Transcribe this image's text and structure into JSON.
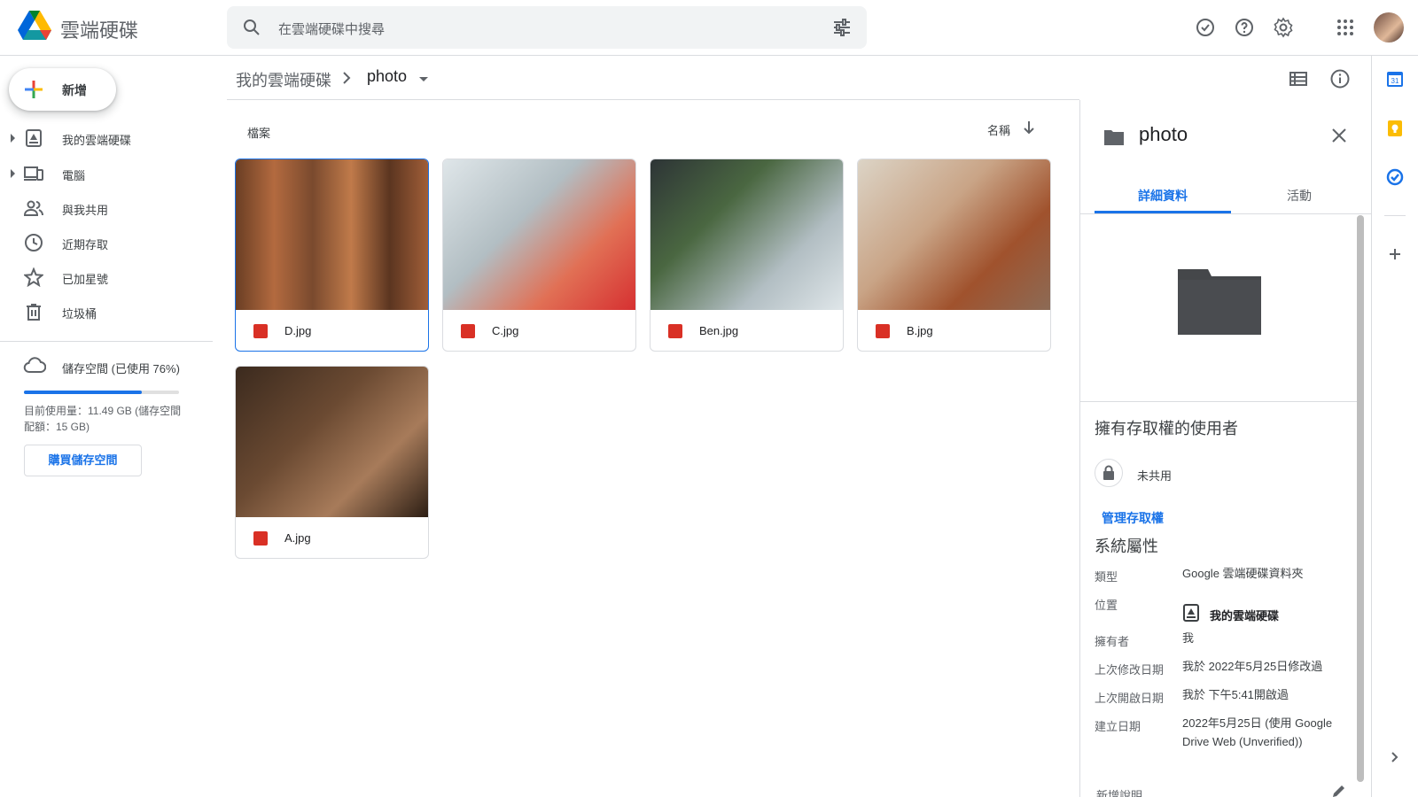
{
  "app": {
    "title": "雲端硬碟"
  },
  "search": {
    "placeholder": "在雲端硬碟中搜尋"
  },
  "sidebar": {
    "new_label": "新增",
    "items": [
      {
        "label": "我的雲端硬碟",
        "icon": "my-drive-icon"
      },
      {
        "label": "電腦",
        "icon": "computer-icon"
      },
      {
        "label": "與我共用",
        "icon": "shared-icon"
      },
      {
        "label": "近期存取",
        "icon": "clock-icon"
      },
      {
        "label": "已加星號",
        "icon": "star-icon"
      },
      {
        "label": "垃圾桶",
        "icon": "trash-icon"
      }
    ],
    "storage": {
      "title": "儲存空間 (已使用 76%)",
      "used_fraction": 0.76,
      "detail": "目前使用量：11.49 GB (儲存空間配額：15 GB)",
      "buy_label": "購買儲存空間"
    }
  },
  "breadcrumb": {
    "root": "我的雲端硬碟",
    "current": "photo"
  },
  "files": {
    "section_label": "檔案",
    "sort_label": "名稱",
    "items": [
      {
        "name": "D.jpg",
        "selected": true
      },
      {
        "name": "C.jpg",
        "selected": false
      },
      {
        "name": "Ben.jpg",
        "selected": false
      },
      {
        "name": "B.jpg",
        "selected": false
      },
      {
        "name": "A.jpg",
        "selected": false
      }
    ]
  },
  "details": {
    "title": "photo",
    "tabs": [
      "詳細資料",
      "活動"
    ],
    "access_heading": "擁有存取權的使用者",
    "share_status": "未共用",
    "manage_access": "管理存取權",
    "system_heading": "系統屬性",
    "props": [
      {
        "key": "類型",
        "value": "Google 雲端硬碟資料夾"
      },
      {
        "key": "位置",
        "value": "我的雲端硬碟"
      },
      {
        "key": "擁有者",
        "value": "我"
      },
      {
        "key": "上次修改日期",
        "value": "我於 2022年5月25日修改過"
      },
      {
        "key": "上次開啟日期",
        "value": "我於 下午5:41開啟過"
      },
      {
        "key": "建立日期",
        "value": "2022年5月25日 (使用 Google Drive Web (Unverified))"
      }
    ],
    "add_description": "新增說明"
  },
  "colors": {
    "accent": "#1a73e8",
    "image_icon": "#d93025"
  }
}
